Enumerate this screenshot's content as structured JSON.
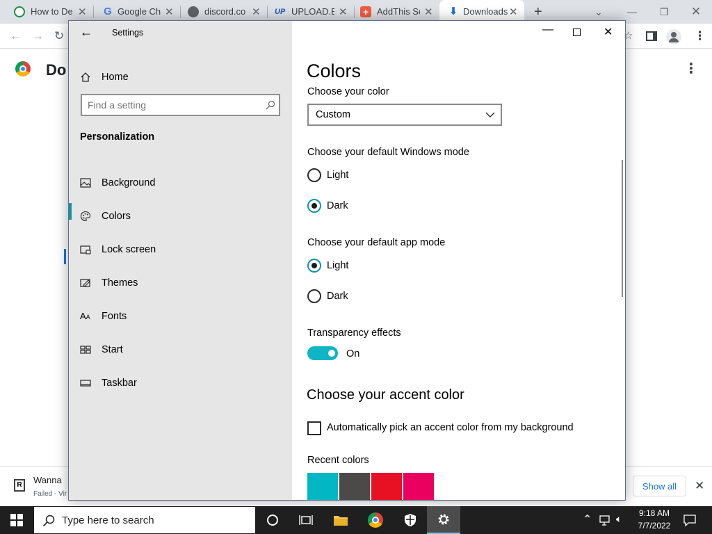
{
  "chrome": {
    "tabs": [
      {
        "title": "How to De",
        "favicon_color": "#1e8e3e"
      },
      {
        "title": "Google Ch",
        "favicon_color": "#4285f4"
      },
      {
        "title": "discord.co",
        "favicon_color": "#5f6368"
      },
      {
        "title": "UPLOAD.EL",
        "favicon_color": "#1a56b6"
      },
      {
        "title": "AddThis Sc",
        "favicon_color": "#f15b40"
      },
      {
        "title": "Downloads",
        "favicon_color": "#1a73e8"
      }
    ],
    "new_tab_label": "+",
    "page_title_fragment": "Do",
    "download_item": {
      "name": "Wanna",
      "status": "Failed - Vir"
    },
    "show_all_label": "Show all"
  },
  "settings": {
    "app_title": "Settings",
    "home_label": "Home",
    "search_placeholder": "Find a setting",
    "section_label": "Personalization",
    "nav": [
      {
        "label": "Background",
        "icon": "picture-icon"
      },
      {
        "label": "Colors",
        "icon": "palette-icon",
        "selected": true
      },
      {
        "label": "Lock screen",
        "icon": "lock-screen-icon"
      },
      {
        "label": "Themes",
        "icon": "themes-icon"
      },
      {
        "label": "Fonts",
        "icon": "fonts-icon"
      },
      {
        "label": "Start",
        "icon": "start-icon"
      },
      {
        "label": "Taskbar",
        "icon": "taskbar-icon"
      }
    ],
    "page_title": "Colors",
    "choose_color_label": "Choose your color",
    "color_select_value": "Custom",
    "windows_mode_heading": "Choose your default Windows mode",
    "windows_mode_options": [
      "Light",
      "Dark"
    ],
    "windows_mode_selected": "Dark",
    "app_mode_heading": "Choose your default app mode",
    "app_mode_options": [
      "Light",
      "Dark"
    ],
    "app_mode_selected": "Light",
    "transparency_heading": "Transparency effects",
    "transparency_state": "On",
    "accent_heading": "Choose your accent color",
    "auto_accent_label": "Automatically pick an accent color from my background",
    "recent_colors_heading": "Recent colors",
    "recent_colors": [
      "#00b7c3",
      "#4c4a48",
      "#e81123",
      "#ea005e"
    ],
    "accent_color": "#0f95a7"
  },
  "taskbar": {
    "search_placeholder": "Type here to search",
    "time": "9:18 AM",
    "date": "7/7/2022"
  }
}
